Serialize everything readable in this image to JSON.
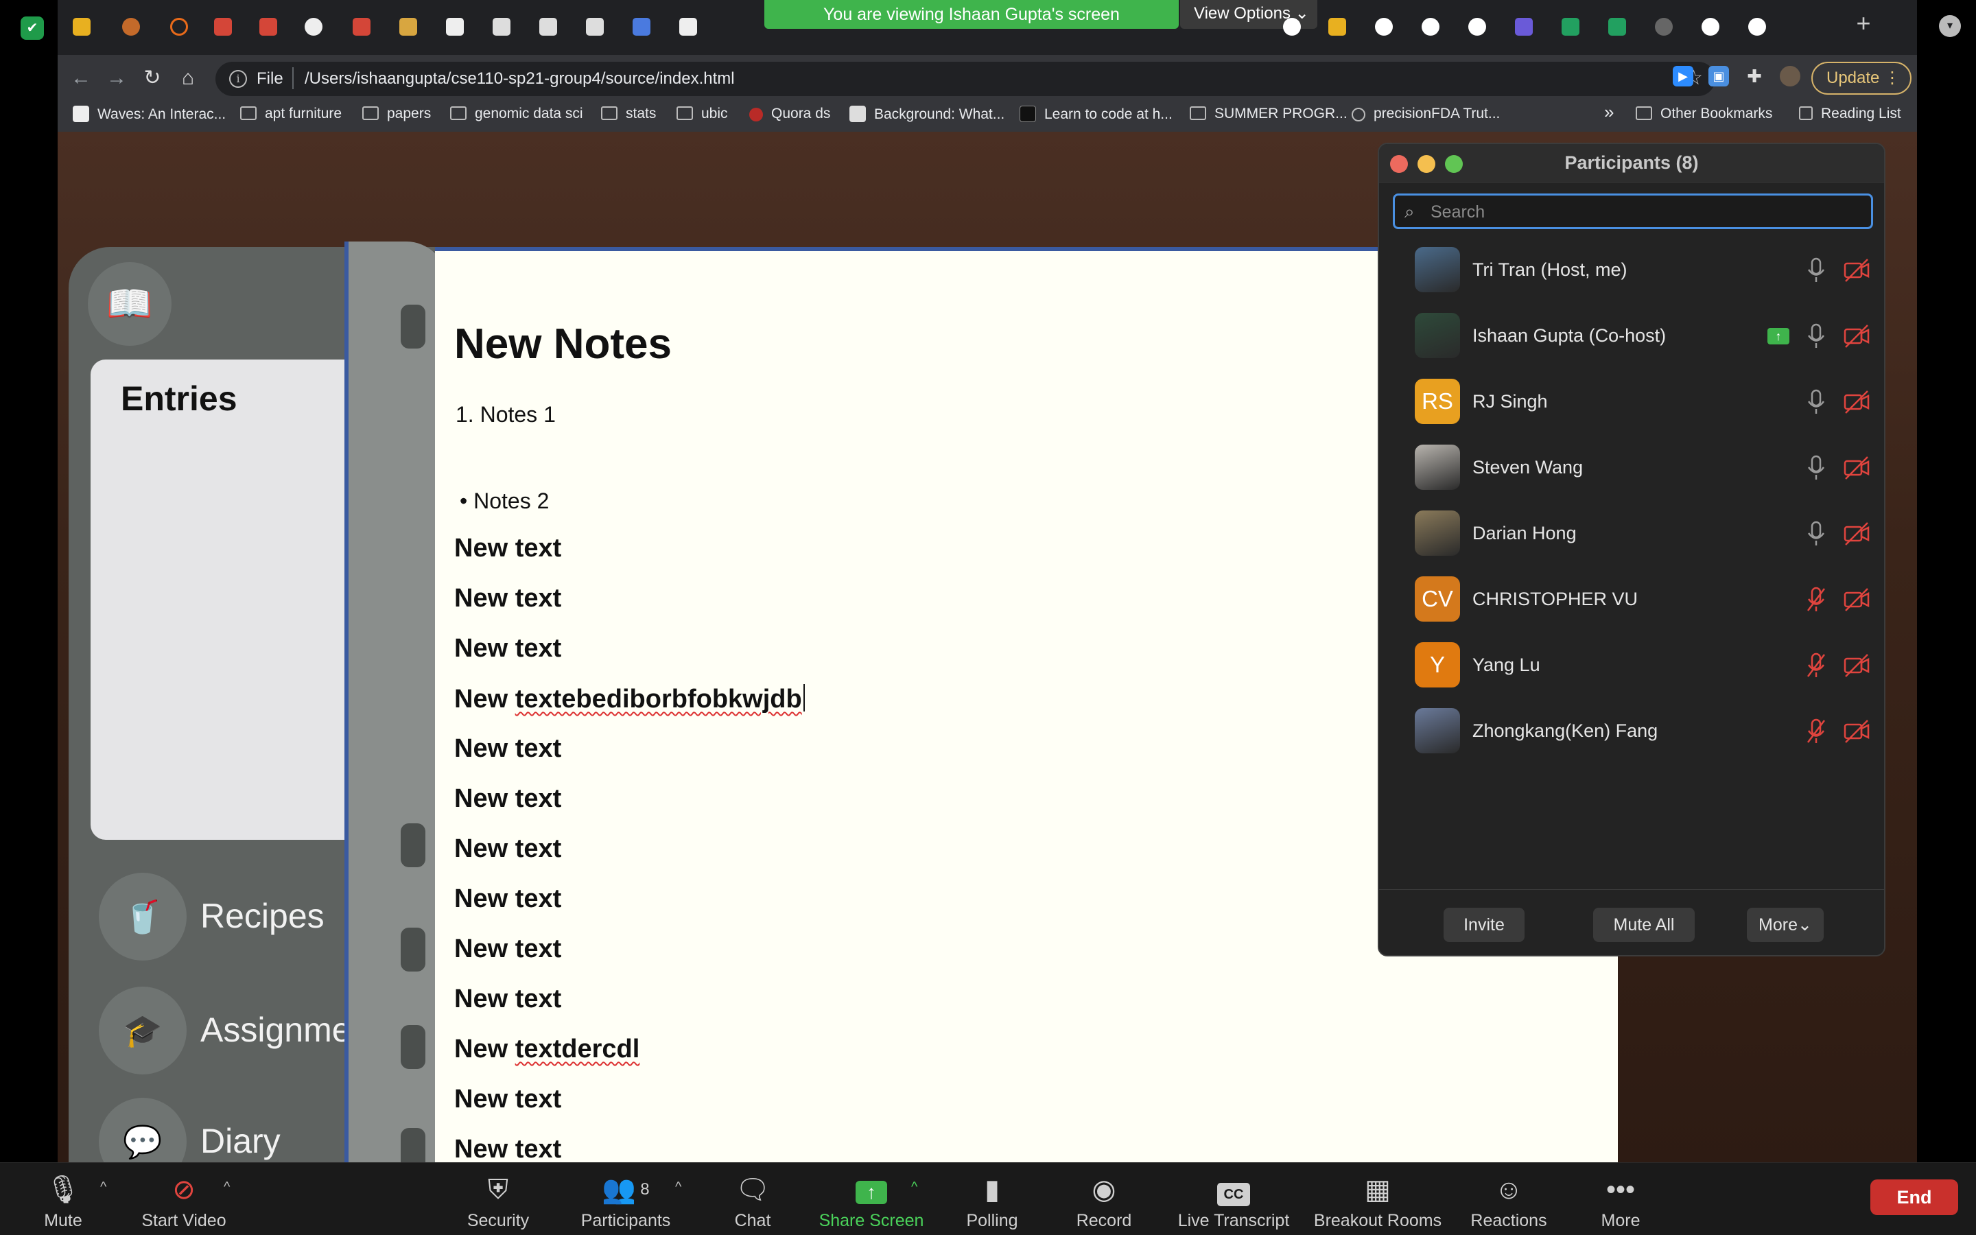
{
  "banner": {
    "viewing": "You are viewing Ishaan Gupta's screen",
    "view_options": "View Options"
  },
  "browser": {
    "url_scheme": "File",
    "url": "/Users/ishaangupta/cse110-sp21-group4/source/index.html",
    "update_label": "Update",
    "bookmarks": [
      {
        "label": "Waves: An Interac...",
        "icon": "favicon"
      },
      {
        "label": "apt furniture",
        "icon": "folder-icon"
      },
      {
        "label": "papers",
        "icon": "folder-icon"
      },
      {
        "label": "genomic data sci",
        "icon": "folder-icon"
      },
      {
        "label": "stats",
        "icon": "folder-icon"
      },
      {
        "label": "ubic",
        "icon": "folder-icon"
      },
      {
        "label": "Quora ds",
        "icon": "quora-icon"
      },
      {
        "label": "Background: What...",
        "icon": "favicon"
      },
      {
        "label": "Learn to code at h...",
        "icon": "favicon"
      },
      {
        "label": "SUMMER PROGR...",
        "icon": "folder-icon"
      },
      {
        "label": "precisionFDA Trut...",
        "icon": "favicon"
      }
    ],
    "overflow_label": "»",
    "other_bookmarks": "Other Bookmarks",
    "reading_list": "Reading List"
  },
  "app": {
    "entries_title": "Entries",
    "nav": [
      {
        "label": "Recipes",
        "icon": "recipes-icon"
      },
      {
        "label": "Assignments",
        "icon": "graduation-cap-icon"
      },
      {
        "label": "Diary",
        "icon": "chat-bubble-icon"
      }
    ],
    "notes_title": "New Notes",
    "ordered_item": "1. Notes 1",
    "bullet_item": "• Notes 2",
    "lines": [
      {
        "prefix": "New",
        "word": "text"
      },
      {
        "prefix": "New",
        "word": "text"
      },
      {
        "prefix": "New",
        "word": "text"
      },
      {
        "prefix": "New",
        "word": "textebediborbfobkwjdb"
      },
      {
        "prefix": "New",
        "word": "text"
      },
      {
        "prefix": "New",
        "word": "text"
      },
      {
        "prefix": "New",
        "word": "text"
      },
      {
        "prefix": "New",
        "word": "text"
      },
      {
        "prefix": "New",
        "word": "text"
      },
      {
        "prefix": "New",
        "word": "text"
      },
      {
        "prefix": "New",
        "word": "textdercdl"
      },
      {
        "prefix": "New",
        "word": "text"
      },
      {
        "prefix": "New",
        "word": "text"
      }
    ]
  },
  "participants": {
    "title": "Participants (8)",
    "search_placeholder": "Search",
    "list": [
      {
        "name": "Tri Tran (Host, me)",
        "avatar": "photo",
        "initials": "",
        "color": "#4a6a8a",
        "muted": false,
        "sharing": false
      },
      {
        "name": "Ishaan Gupta (Co-host)",
        "avatar": "photo",
        "initials": "",
        "color": "#2e4a3a",
        "muted": false,
        "sharing": true
      },
      {
        "name": "RJ Singh",
        "avatar": "initials",
        "initials": "RS",
        "color": "#e8a020",
        "muted": false,
        "sharing": false
      },
      {
        "name": "Steven Wang",
        "avatar": "photo",
        "initials": "",
        "color": "#b8b4ae",
        "muted": false,
        "sharing": false
      },
      {
        "name": "Darian Hong",
        "avatar": "photo",
        "initials": "",
        "color": "#8a7a5a",
        "muted": false,
        "sharing": false
      },
      {
        "name": "CHRISTOPHER VU",
        "avatar": "initials",
        "initials": "CV",
        "color": "#d4791c",
        "muted": true,
        "sharing": false
      },
      {
        "name": "Yang Lu",
        "avatar": "initials",
        "initials": "Y",
        "color": "#e07a10",
        "muted": true,
        "sharing": false
      },
      {
        "name": "Zhongkang(Ken) Fang",
        "avatar": "photo",
        "initials": "",
        "color": "#6a7a9a",
        "muted": true,
        "sharing": false
      }
    ],
    "invite": "Invite",
    "mute_all": "Mute All",
    "more": "More"
  },
  "zoom_bar": {
    "mute": "Mute",
    "start_video": "Start Video",
    "security": "Security",
    "participants": "Participants",
    "participants_count": "8",
    "chat": "Chat",
    "share_screen": "Share Screen",
    "polling": "Polling",
    "record": "Record",
    "live_transcript": "Live Transcript",
    "breakout_rooms": "Breakout Rooms",
    "reactions": "Reactions",
    "more": "More",
    "end": "End"
  },
  "colors": {
    "share_green": "#3fb44c",
    "end_red": "#c9302c",
    "accent_blue": "#4a90e2",
    "muted_red": "#e0443e"
  }
}
